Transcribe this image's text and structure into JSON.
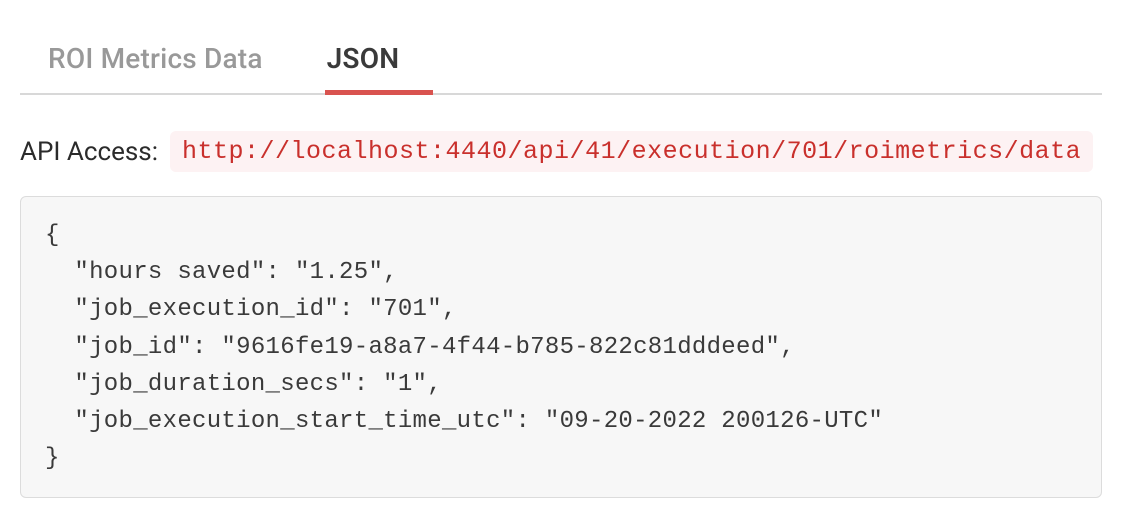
{
  "tabs": {
    "roi_metrics": "ROI Metrics Data",
    "json": "JSON",
    "active": "json"
  },
  "api": {
    "label": "API Access:",
    "url": "http://localhost:4440/api/41/execution/701/roimetrics/data"
  },
  "json_body": "{\n  \"hours saved\": \"1.25\",\n  \"job_execution_id\": \"701\",\n  \"job_id\": \"9616fe19-a8a7-4f44-b785-822c81dddeed\",\n  \"job_duration_secs\": \"1\",\n  \"job_execution_start_time_utc\": \"09-20-2022 200126-UTC\"\n}",
  "roi_data": {
    "hours saved": "1.25",
    "job_execution_id": "701",
    "job_id": "9616fe19-a8a7-4f44-b785-822c81dddeed",
    "job_duration_secs": "1",
    "job_execution_start_time_utc": "09-20-2022 200126-UTC"
  }
}
